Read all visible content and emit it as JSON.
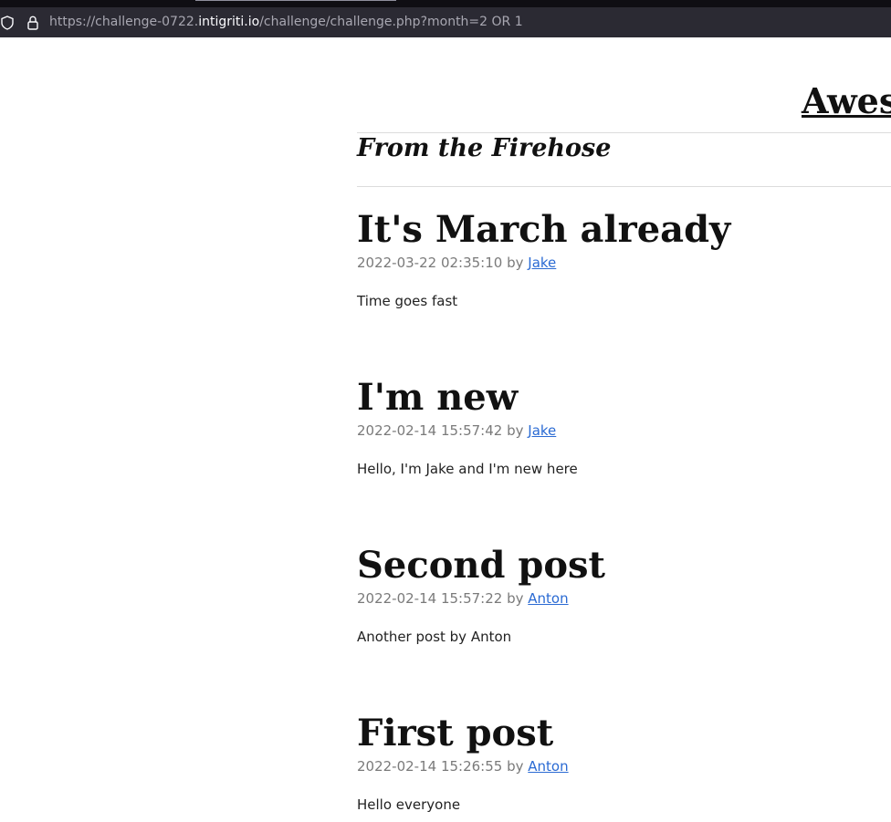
{
  "browser": {
    "url_prefix": "https://challenge-0722.",
    "url_host": "intigriti.io",
    "url_path": "/challenge/challenge.php?month=2 OR 1"
  },
  "site": {
    "title": "Aweso",
    "subtitle": "From the Firehose"
  },
  "posts": [
    {
      "title": "It's March already",
      "timestamp": "2022-03-22 02:35:10",
      "by": "by",
      "author": "Jake",
      "body": "Time goes fast"
    },
    {
      "title": "I'm new",
      "timestamp": "2022-02-14 15:57:42",
      "by": "by",
      "author": "Jake",
      "body": "Hello, I'm Jake and I'm new here"
    },
    {
      "title": "Second post",
      "timestamp": "2022-02-14 15:57:22",
      "by": "by",
      "author": "Anton",
      "body": "Another post by Anton"
    },
    {
      "title": "First post",
      "timestamp": "2022-02-14 15:26:55",
      "by": "by",
      "author": "Anton",
      "body": "Hello everyone"
    }
  ]
}
